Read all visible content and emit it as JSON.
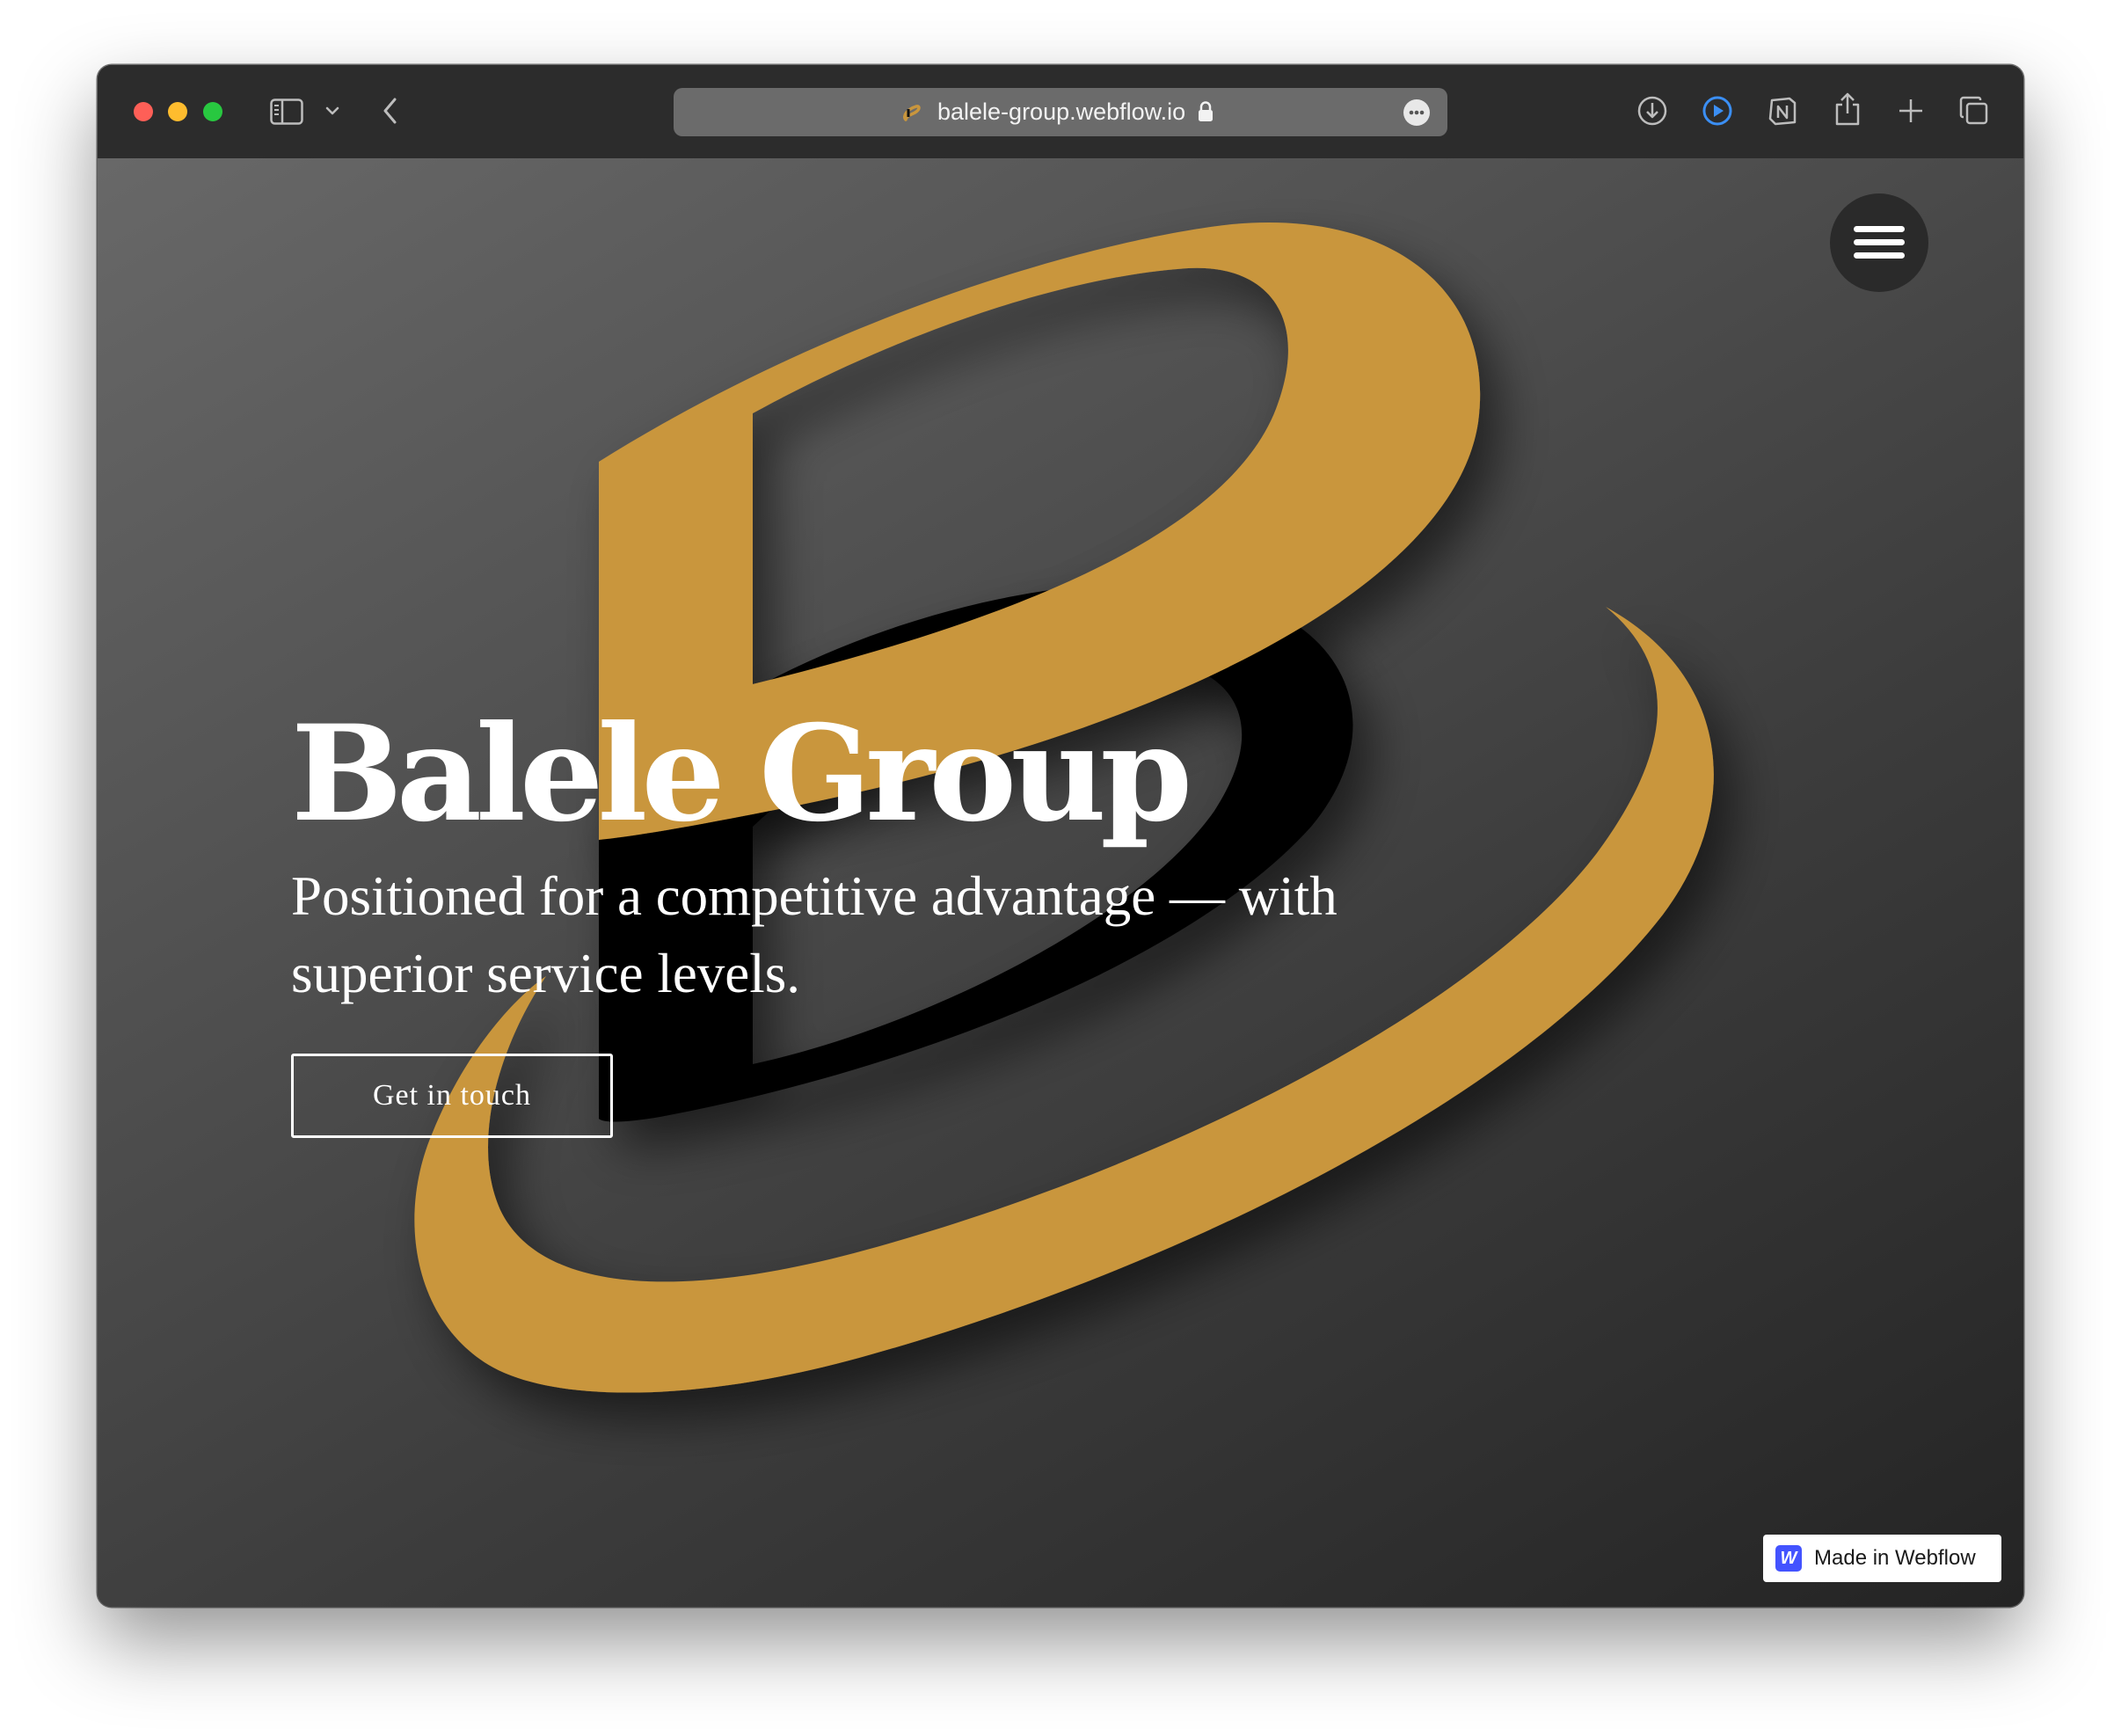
{
  "browser": {
    "url": "balele-group.webflow.io",
    "icons": {
      "sidebar": "sidebar-icon",
      "sidebar_menu": "chevron-down-icon",
      "back": "chevron-left-icon",
      "favicon": "site-favicon-icon",
      "lock": "lock-icon",
      "page_menu": "ellipsis-icon",
      "downloads": "download-icon",
      "extension_player": "play-icon",
      "extension_notion": "notion-icon",
      "share": "share-icon",
      "new_tab": "plus-icon",
      "tab_overview": "tabs-icon"
    }
  },
  "hero": {
    "title": "Balele Group",
    "subtitle": "Positioned for a competitive advantage — with superior service levels.",
    "cta_label": "Get in touch"
  },
  "nav": {
    "menu_icon": "hamburger-icon"
  },
  "badge": {
    "logo_letter": "W",
    "label": "Made in Webflow"
  },
  "colors": {
    "accent_gold": "#c9963d",
    "logo_dark": "#000000",
    "background_dark": "#2a2a2a",
    "webflow_blue": "#4353ff"
  }
}
